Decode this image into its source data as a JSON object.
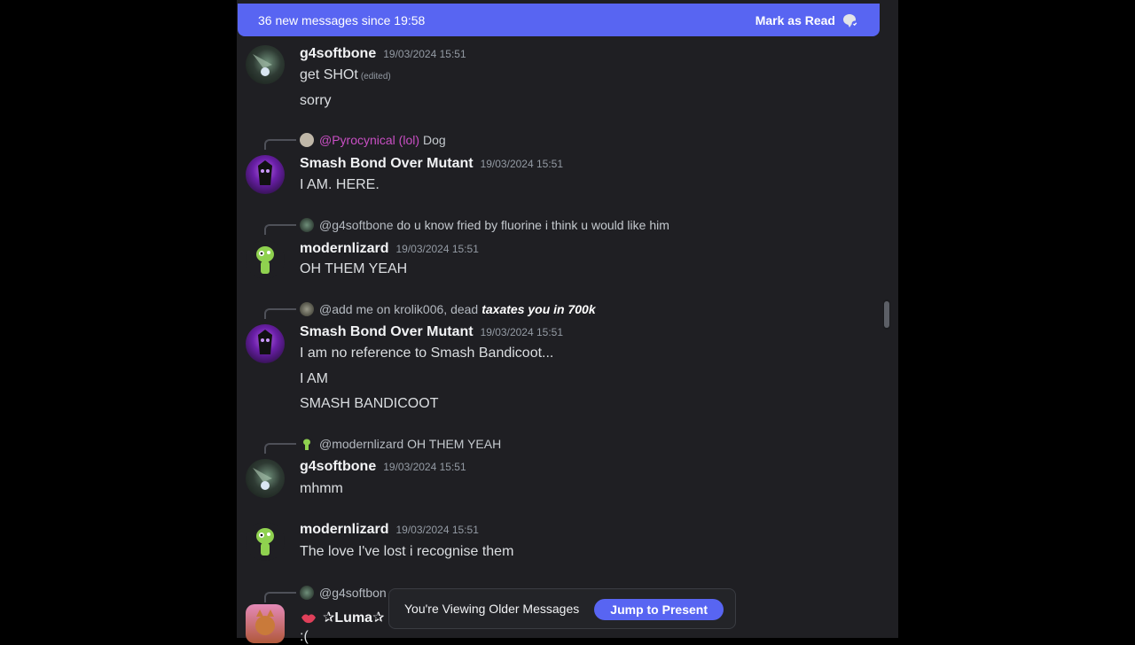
{
  "banner": {
    "text": "36 new messages since 19:58",
    "action": "Mark as Read"
  },
  "messages": [
    {
      "author": "g4softbone",
      "time": "19/03/2024 15:51",
      "lines": [
        "get SHOt",
        "sorry"
      ],
      "edited": "(edited)"
    },
    {
      "reply_mention": "@Pyrocynical (lol)",
      "reply_text": "Dog",
      "author": "Smash Bond Over Mutant",
      "time": "19/03/2024 15:51",
      "lines": [
        "I AM. HERE."
      ]
    },
    {
      "reply_mention": "@g4softbone",
      "reply_text": "do u know fried by fluorine i think u would like him",
      "author": "modernlizard",
      "time": "19/03/2024 15:51",
      "lines": [
        "OH THEM YEAH"
      ]
    },
    {
      "reply_mention": "@add me on krolik006, dead",
      "reply_text": "taxates you in 700k",
      "author": "Smash Bond Over Mutant",
      "time": "19/03/2024 15:51",
      "lines": [
        "I am no reference to Smash Bandicoot...",
        "I AM",
        "SMASH BANDICOOT"
      ]
    },
    {
      "reply_mention": "@modernlizard",
      "reply_text": "OH THEM YEAH",
      "author": "g4softbone",
      "time": "19/03/2024 15:51",
      "lines": [
        "mhmm"
      ]
    },
    {
      "author": "modernlizard",
      "time": "19/03/2024 15:51",
      "lines": [
        "The love I've lost i recognise them"
      ]
    },
    {
      "reply_mention": "@g4softbon",
      "author": "✰Luma✰",
      "lines": [
        ":("
      ]
    }
  ],
  "older_bar": {
    "text": "You're Viewing Older Messages",
    "button": "Jump to Present"
  },
  "colors": {
    "accent": "#5865f2",
    "background": "#1f1f23",
    "pyro_mention": "#c94fc4"
  }
}
